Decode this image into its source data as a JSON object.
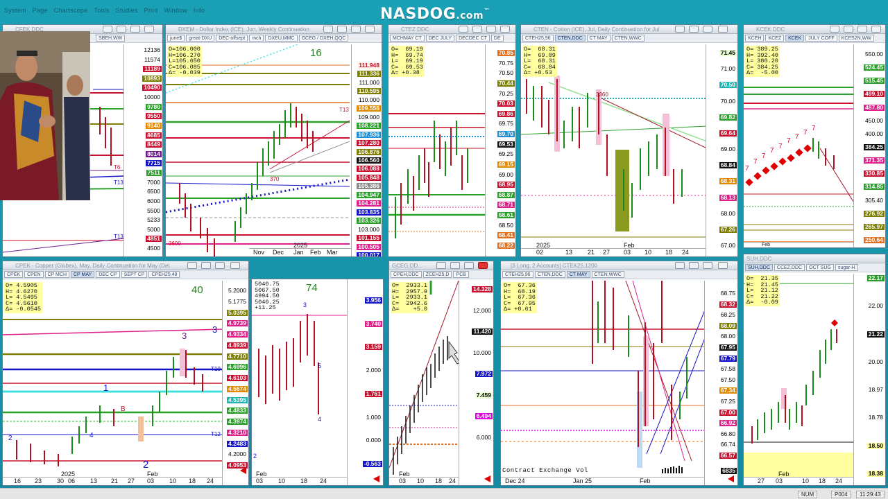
{
  "app": {
    "menu": "System  Page  Chartscope  Tools  Studies  Print  Window  Info",
    "brand": "NASDOG",
    "brand_suffix": ".com",
    "brand_tm": "™"
  },
  "status": {
    "num": "NUM",
    "page": "P004",
    "clock": "11:29:43"
  },
  "colors": {
    "red": "#c8102e",
    "green": "#0d7a0d",
    "blue": "#1414c8",
    "olive": "#7d7d00"
  },
  "charts": {
    "cfek": {
      "title": "CFEK DDC",
      "tabs": [
        "SBEH,WW"
      ],
      "prices": [
        {
          "v": "12136",
          "c": "#ffffff",
          "t": "#000"
        },
        {
          "v": "11574",
          "c": "#ffffff",
          "t": "#000"
        },
        {
          "v": "11189",
          "c": "#c8102e",
          "t": "#fff"
        },
        {
          "v": "10893",
          "c": "#7d7d00",
          "t": "#fff"
        },
        {
          "v": "10490",
          "c": "#c8102e",
          "t": "#fff"
        },
        {
          "v": "10000",
          "c": "#ffffff",
          "t": "#000"
        },
        {
          "v": "9780",
          "c": "#2aa02a",
          "t": "#fff"
        },
        {
          "v": "9550",
          "c": "#c8102e",
          "t": "#fff"
        },
        {
          "v": "9140",
          "c": "#e08a00",
          "t": "#fff"
        },
        {
          "v": "8685",
          "c": "#c8102e",
          "t": "#fff"
        },
        {
          "v": "8449",
          "c": "#c8102e",
          "t": "#fff"
        },
        {
          "v": "8014",
          "c": "#6d1a8a",
          "t": "#fff"
        },
        {
          "v": "7715",
          "c": "#1414c8",
          "t": "#fff"
        },
        {
          "v": "7511",
          "c": "#2aa02a",
          "t": "#fff"
        },
        {
          "v": "7000",
          "c": "#ffffff",
          "t": "#000"
        },
        {
          "v": "6500",
          "c": "#ffffff",
          "t": "#000"
        },
        {
          "v": "6000",
          "c": "#ffffff",
          "t": "#000"
        },
        {
          "v": "5500",
          "c": "#ffffff",
          "t": "#000"
        },
        {
          "v": "5233",
          "c": "#ffffff",
          "t": "#000"
        },
        {
          "v": "5000",
          "c": "#ffffff",
          "t": "#000"
        },
        {
          "v": "4851",
          "c": "#c8102e",
          "t": "#fff"
        },
        {
          "v": "4500",
          "c": "#ffffff",
          "t": "#000"
        }
      ]
    },
    "dxem": {
      "title": "DXEM - Dollar Index (ICE), Jun, Weekly Continuation",
      "tabs": [
        "june$",
        "great-DXU",
        "DEC-offsept",
        "mch",
        "DXEU,MMC",
        "GCEG / DXEH,QQC"
      ],
      "ohlc": "O=106.000\nH=106.270\nL=105.650\nC=106.085\nΔ= -0.039",
      "count": "16",
      "prices": [
        {
          "v": "111.948",
          "c": "#fff3e6",
          "t": "#c8102e"
        },
        {
          "v": "111.336",
          "c": "#7d7d00",
          "t": "#fff"
        },
        {
          "v": "111.000",
          "c": "#ffffff",
          "t": "#000"
        },
        {
          "v": "110.595",
          "c": "#7d7d00",
          "t": "#fff"
        },
        {
          "v": "110.000",
          "c": "#ffffff",
          "t": "#000"
        },
        {
          "v": "109.556",
          "c": "#e08a00",
          "t": "#fff"
        },
        {
          "v": "109.000",
          "c": "#ffffff",
          "t": "#000"
        },
        {
          "v": "108.221",
          "c": "#2aa02a",
          "t": "#fff"
        },
        {
          "v": "107.936",
          "c": "#1f8fd6",
          "t": "#fff"
        },
        {
          "v": "107.280",
          "c": "#c8102e",
          "t": "#fff"
        },
        {
          "v": "106.876",
          "c": "#7d7d00",
          "t": "#fff"
        },
        {
          "v": "106.560",
          "c": "#111",
          "t": "#fff"
        },
        {
          "v": "106.088",
          "c": "#c8102e",
          "t": "#fff"
        },
        {
          "v": "105.848",
          "c": "#c8102e",
          "t": "#fff"
        },
        {
          "v": "105.386",
          "c": "#888",
          "t": "#fff"
        },
        {
          "v": "104.947",
          "c": "#2aa02a",
          "t": "#fff"
        },
        {
          "v": "104.281",
          "c": "#e0208a",
          "t": "#fff"
        },
        {
          "v": "103.835",
          "c": "#1414c8",
          "t": "#fff"
        },
        {
          "v": "103.326",
          "c": "#2aa02a",
          "t": "#fff"
        },
        {
          "v": "103.000",
          "c": "#ffffff",
          "t": "#000"
        },
        {
          "v": "101.155",
          "c": "#c8102e",
          "t": "#fff"
        },
        {
          "v": "100.505",
          "c": "#e0208a",
          "t": "#fff"
        },
        {
          "v": "100.017",
          "c": "#1414c8",
          "t": "#fff"
        }
      ],
      "months": [
        "Nov",
        "Dec",
        "2025",
        "Jan",
        "Feb",
        "Mar"
      ]
    },
    "ctez": {
      "title": "CTEZ DDC",
      "tabs": [
        "MCHMAY CT",
        "DEC JULY",
        "DECDEC CT",
        "DE"
      ],
      "ohlc": "O=  69.19\nH=  69.74\nL=  69.19\nC=  69.53\nΔ= +0.38",
      "prices": [
        {
          "v": "70.85",
          "c": "#e07020",
          "t": "#fff"
        },
        {
          "v": "70.75",
          "c": "#ffffff",
          "t": "#000"
        },
        {
          "v": "70.50",
          "c": "#ffffff",
          "t": "#000"
        },
        {
          "v": "70.44",
          "c": "#7d7d00",
          "t": "#fff"
        },
        {
          "v": "70.25",
          "c": "#ffffff",
          "t": "#000"
        },
        {
          "v": "70.03",
          "c": "#c8102e",
          "t": "#fff"
        },
        {
          "v": "69.86",
          "c": "#c8102e",
          "t": "#fff"
        },
        {
          "v": "69.75",
          "c": "#ffffff",
          "t": "#000"
        },
        {
          "v": "69.70",
          "c": "#1f8fd6",
          "t": "#fff"
        },
        {
          "v": "69.53",
          "c": "#111",
          "t": "#fff"
        },
        {
          "v": "69.25",
          "c": "#ffffff",
          "t": "#000"
        },
        {
          "v": "69.15",
          "c": "#e08a00",
          "t": "#fff"
        },
        {
          "v": "69.00",
          "c": "#ffffff",
          "t": "#000"
        },
        {
          "v": "68.95",
          "c": "#c8102e",
          "t": "#fff"
        },
        {
          "v": "68.87",
          "c": "#2aa02a",
          "t": "#fff"
        },
        {
          "v": "68.71",
          "c": "#e0208a",
          "t": "#fff"
        },
        {
          "v": "68.61",
          "c": "#2aa02a",
          "t": "#fff"
        },
        {
          "v": "68.50",
          "c": "#ffffff",
          "t": "#000"
        },
        {
          "v": "68.41",
          "c": "#e07020",
          "t": "#fff"
        },
        {
          "v": "68.22",
          "c": "#e07020",
          "t": "#fff"
        }
      ]
    },
    "cten": {
      "title": "CTEN - Cotton (ICE), Jul, Daily Continuation for Jul",
      "tabs": [
        "CTEH25,96",
        "CTEN,DDC",
        "CT MAY",
        "CTEN,WWC"
      ],
      "ohlc": "O=  68.31\nH=  69.09\nL=  68.31\nC=  68.84\nΔ= +0.53",
      "marker": "3360",
      "prices": [
        {
          "v": "71.45",
          "c": "#eaffd0",
          "t": "#000"
        },
        {
          "v": "71.00",
          "c": "#ffffff",
          "t": "#000"
        },
        {
          "v": "70.50",
          "c": "#1fb3b3",
          "t": "#fff"
        },
        {
          "v": "70.00",
          "c": "#ffffff",
          "t": "#000"
        },
        {
          "v": "69.82",
          "c": "#2aa02a",
          "t": "#fff"
        },
        {
          "v": "69.64",
          "c": "#c8102e",
          "t": "#fff"
        },
        {
          "v": "69.00",
          "c": "#ffffff",
          "t": "#000"
        },
        {
          "v": "68.84",
          "c": "#111",
          "t": "#fff"
        },
        {
          "v": "68.31",
          "c": "#e08a00",
          "t": "#fff"
        },
        {
          "v": "68.13",
          "c": "#e0208a",
          "t": "#fff"
        },
        {
          "v": "68.00",
          "c": "#ffffff",
          "t": "#000"
        },
        {
          "v": "67.26",
          "c": "#7d7d00",
          "t": "#fff"
        },
        {
          "v": "67.00",
          "c": "#ffffff",
          "t": "#000"
        }
      ],
      "days": [
        "02",
        "13",
        "21",
        "27",
        "03",
        "10",
        "18",
        "24"
      ],
      "year": "2025",
      "month": "Feb"
    },
    "kcek": {
      "title": "KCEK DDC",
      "tabs": [
        "KCEH",
        "KCEZ",
        "KCEK",
        "JULY COFF",
        "KCES2N,WW"
      ],
      "ohlc": "O= 389.25\nH= 392.40\nL= 380.20\nC= 384.25\nΔ=  -5.00",
      "prices": [
        {
          "v": "550.00",
          "c": "#ffffff",
          "t": "#000"
        },
        {
          "v": "524.45",
          "c": "#2aa02a",
          "t": "#fff"
        },
        {
          "v": "515.45",
          "c": "#2aa02a",
          "t": "#fff"
        },
        {
          "v": "499.10",
          "c": "#c8102e",
          "t": "#fff"
        },
        {
          "v": "487.80",
          "c": "#e0208a",
          "t": "#fff"
        },
        {
          "v": "450.00",
          "c": "#ffffff",
          "t": "#000"
        },
        {
          "v": "400.00",
          "c": "#ffffff",
          "t": "#000"
        },
        {
          "v": "384.25",
          "c": "#111",
          "t": "#fff"
        },
        {
          "v": "371.35",
          "c": "#e0208a",
          "t": "#fff"
        },
        {
          "v": "330.85",
          "c": "#c8102e",
          "t": "#fff"
        },
        {
          "v": "314.85",
          "c": "#2aa02a",
          "t": "#fff"
        },
        {
          "v": "305.40",
          "c": "#ffffff",
          "t": "#000"
        },
        {
          "v": "276.92",
          "c": "#7d7d00",
          "t": "#fff"
        },
        {
          "v": "265.97",
          "c": "#7d7d00",
          "t": "#fff"
        },
        {
          "v": "250.64",
          "c": "#e07020",
          "t": "#fff"
        }
      ],
      "month": "Feb"
    },
    "cpek": {
      "title": "CPEK - Copper (Globex), May, Daily Continuation for May (Del",
      "tabs": [
        "CPEK",
        "CPEN",
        "CP MCH",
        "CP MAY",
        "DEC CP",
        "SEPT CP",
        "CPEH25,48"
      ],
      "ohlc": "O= 4.5905\nH= 4.6270\nL= 4.5495\nC= 4.5610\nΔ= -0.0545",
      "count": "40",
      "prices": [
        {
          "v": "5.2000",
          "c": "#ffffff",
          "t": "#000"
        },
        {
          "v": "5.1775",
          "c": "#ffffff",
          "t": "#000"
        },
        {
          "v": "5.0395",
          "c": "#7d7d00",
          "t": "#fff"
        },
        {
          "v": "4.9739",
          "c": "#e0208a",
          "t": "#fff"
        },
        {
          "v": "4.9334",
          "c": "#e0208a",
          "t": "#fff"
        },
        {
          "v": "4.8939",
          "c": "#c8102e",
          "t": "#fff"
        },
        {
          "v": "4.7710",
          "c": "#7d7d00",
          "t": "#fff"
        },
        {
          "v": "4.6996",
          "c": "#2aa02a",
          "t": "#fff"
        },
        {
          "v": "4.6103",
          "c": "#c8102e",
          "t": "#fff"
        },
        {
          "v": "4.5674",
          "c": "#e08a00",
          "t": "#fff"
        },
        {
          "v": "4.5395",
          "c": "#1fb3b3",
          "t": "#fff"
        },
        {
          "v": "4.4833",
          "c": "#2aa02a",
          "t": "#fff"
        },
        {
          "v": "4.3974",
          "c": "#2aa02a",
          "t": "#fff"
        },
        {
          "v": "4.3210",
          "c": "#e0208a",
          "t": "#fff"
        },
        {
          "v": "4.2483",
          "c": "#1414c8",
          "t": "#fff"
        },
        {
          "v": "4.2000",
          "c": "#ffffff",
          "t": "#000"
        },
        {
          "v": "4.0953",
          "c": "#c8102e",
          "t": "#fff"
        }
      ],
      "days": [
        "16",
        "23",
        "30",
        "06",
        "13",
        "21",
        "27",
        "03",
        "10",
        "18",
        "24"
      ],
      "year": "2025",
      "month": "Feb"
    },
    "mid": {
      "ohlc": "5040.75\n5067.50\n4994.50\n5040.25\n+11.25",
      "count": "74",
      "prices": [
        {
          "v": "3.956",
          "c": "#1414c8",
          "t": "#fff"
        },
        {
          "v": "3.740",
          "c": "#e0208a",
          "t": "#fff"
        },
        {
          "v": "3.159",
          "c": "#c8102e",
          "t": "#fff"
        },
        {
          "v": "2.000",
          "c": "#ffffff",
          "t": "#000"
        },
        {
          "v": "1.761",
          "c": "#c8102e",
          "t": "#fff"
        },
        {
          "v": "1.000",
          "c": "#ffffff",
          "t": "#000"
        },
        {
          "v": "0.000",
          "c": "#ffffff",
          "t": "#000"
        },
        {
          "v": "-0.563",
          "c": "#1414c8",
          "t": "#fff"
        }
      ],
      "days": [
        "03",
        "10",
        "18",
        "24"
      ],
      "month": "Feb"
    },
    "gceg": {
      "title": "GCEG.DD...",
      "tabs": [
        "CPEH,DDC",
        "ZCEH25,D",
        "PCB"
      ],
      "ohlc": "O=  2933.1\nH=  2957.9\nL=  2933.1\nC=  2942.6\nΔ=    +5.0",
      "prices": [
        {
          "v": "14.328",
          "c": "#c8102e",
          "t": "#fff"
        },
        {
          "v": "12.000",
          "c": "#ffffff",
          "t": "#000"
        },
        {
          "v": "11.420",
          "c": "#111",
          "t": "#fff"
        },
        {
          "v": "10.000",
          "c": "#ffffff",
          "t": "#000"
        },
        {
          "v": "7.972",
          "c": "#1414c8",
          "t": "#fff"
        },
        {
          "v": "7.459",
          "c": "#eaffd0",
          "t": "#000"
        },
        {
          "v": "6.494",
          "c": "#e000e0",
          "t": "#fff"
        },
        {
          "v": "6.000",
          "c": "#ffffff",
          "t": "#000"
        }
      ],
      "days": [
        "03",
        "10",
        "18",
        "24"
      ],
      "month": "Feb"
    },
    "spread": {
      "title": "[3 Long, 2 Accounts] CTEK25,1200",
      "tabs": [
        "CTEH25,96",
        "CTEN,DDC",
        "CT MAY",
        "CTEN,WWC"
      ],
      "ohlc": "O=  67.36\nH=  68.19\nL=  67.36\nC=  67.95\nΔ= +0.61",
      "prices": [
        {
          "v": "68.75",
          "c": "#ffffff",
          "t": "#000"
        },
        {
          "v": "68.32",
          "c": "#c8102e",
          "t": "#fff"
        },
        {
          "v": "68.25",
          "c": "#ffffff",
          "t": "#000"
        },
        {
          "v": "68.09",
          "c": "#7d7d00",
          "t": "#fff"
        },
        {
          "v": "68.00",
          "c": "#ffffff",
          "t": "#000"
        },
        {
          "v": "67.95",
          "c": "#111",
          "t": "#fff"
        },
        {
          "v": "67.79",
          "c": "#1414c8",
          "t": "#fff"
        },
        {
          "v": "67.58",
          "c": "#ffffff",
          "t": "#000"
        },
        {
          "v": "67.50",
          "c": "#ffffff",
          "t": "#000"
        },
        {
          "v": "67.34",
          "c": "#e08a00",
          "t": "#fff"
        },
        {
          "v": "67.25",
          "c": "#ffffff",
          "t": "#000"
        },
        {
          "v": "67.00",
          "c": "#c8102e",
          "t": "#fff"
        },
        {
          "v": "66.92",
          "c": "#e0208a",
          "t": "#fff"
        },
        {
          "v": "66.80",
          "c": "#ffffff",
          "t": "#000"
        },
        {
          "v": "66.74",
          "c": "#ffffff",
          "t": "#000"
        },
        {
          "v": "66.57",
          "c": "#c8102e",
          "t": "#fff"
        }
      ],
      "footer": "Contract Exchange Vol",
      "footer_value": "6835",
      "months": [
        "Dec 24",
        "Jan 25",
        "Feb"
      ]
    },
    "suh": {
      "title": "SUH,DDC",
      "tabs": [
        "SUH,DDC",
        "CCEZ,DDC",
        "OCT SUG",
        "sugar-H"
      ],
      "ohlc": "O=  21.35\nH=  21.45\nL=  21.12\nC=  21.22\nΔ=  -0.09",
      "prices": [
        {
          "v": "22.17",
          "c": "#2aa02a",
          "t": "#fff"
        },
        {
          "v": "22.00",
          "c": "#ffffff",
          "t": "#000"
        },
        {
          "v": "21.22",
          "c": "#111",
          "t": "#fff"
        },
        {
          "v": "20.00",
          "c": "#ffffff",
          "t": "#000"
        },
        {
          "v": "18.97",
          "c": "#ffffff",
          "t": "#000"
        },
        {
          "v": "18.78",
          "c": "#ffffff",
          "t": "#000"
        },
        {
          "v": "18.50",
          "c": "#ffffa0",
          "t": "#000"
        },
        {
          "v": "18.38",
          "c": "#ffffa0",
          "t": "#000"
        }
      ],
      "days": [
        "27",
        "03",
        "10",
        "18",
        "24"
      ],
      "month": "Feb"
    }
  }
}
